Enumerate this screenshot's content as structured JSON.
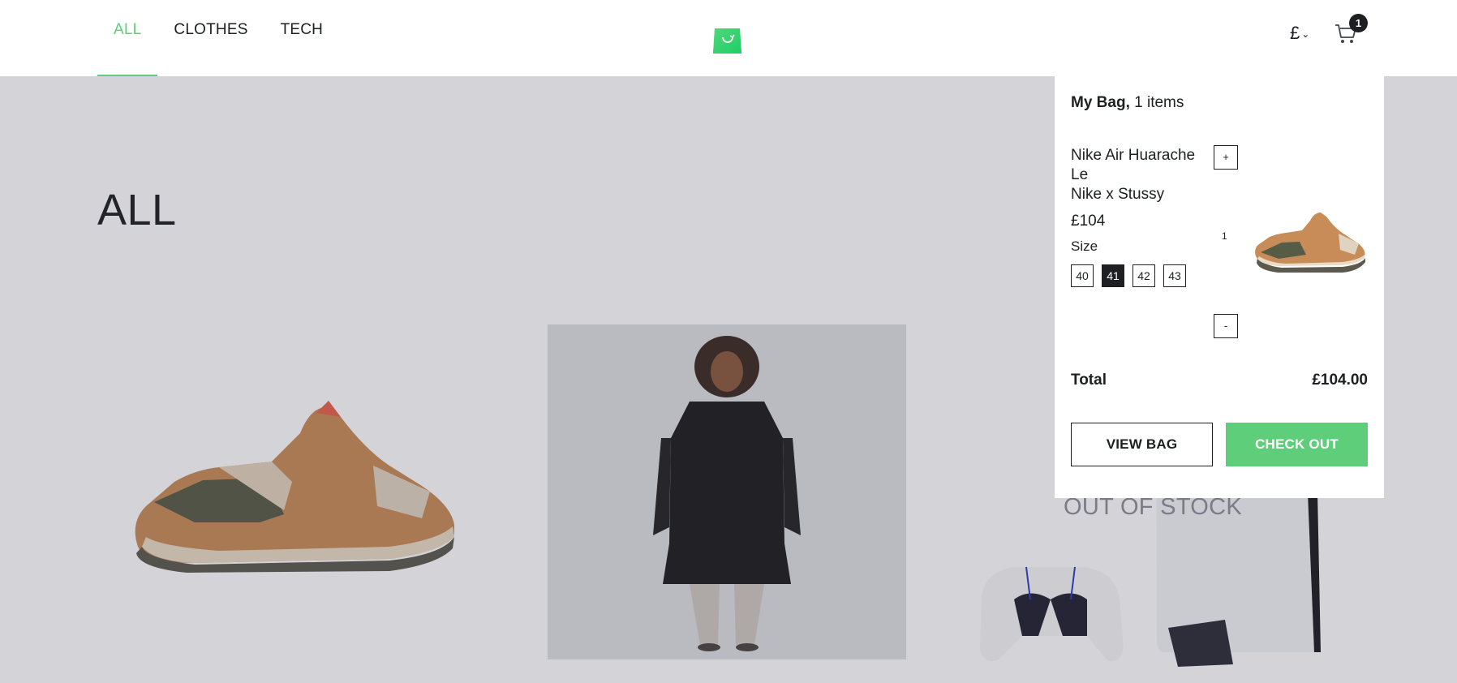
{
  "header": {
    "nav": [
      {
        "label": "ALL",
        "active": true
      },
      {
        "label": "CLOTHES",
        "active": false
      },
      {
        "label": "TECH",
        "active": false
      }
    ],
    "currency": "£",
    "cart_count": "1",
    "logo_icon": "bag-logo-icon",
    "cart_icon": "cart-icon"
  },
  "main": {
    "category_title": "ALL",
    "out_of_stock_label": "OUT OF STOCK"
  },
  "minicart": {
    "title": "My Bag,",
    "count_text": "1 items",
    "item": {
      "name": "Nike Air Huarache Le",
      "brand": "Nike x Stussy",
      "price": "£104",
      "size_label": "Size",
      "sizes": [
        "40",
        "41",
        "42",
        "43"
      ],
      "selected_size": "41",
      "quantity": "1",
      "plus_label": "+",
      "minus_label": "-"
    },
    "total_label": "Total",
    "total_value": "£104.00",
    "view_bag_label": "VIEW BAG",
    "checkout_label": "CHECK OUT"
  },
  "colors": {
    "accent": "#5ece7b",
    "text": "#1d1f22",
    "overlay": "#39374833"
  }
}
